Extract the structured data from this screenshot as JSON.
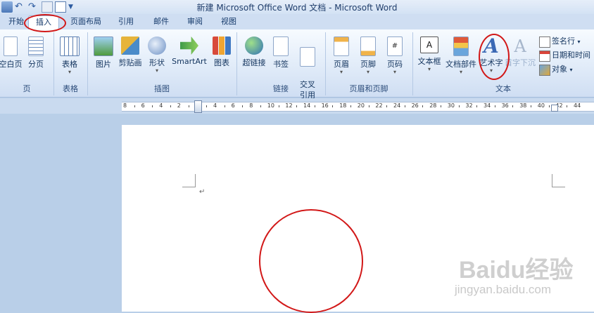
{
  "window": {
    "title": "新建 Microsoft Office Word 文档 - Microsoft Word"
  },
  "tabs": [
    {
      "label": "开始"
    },
    {
      "label": "插入"
    },
    {
      "label": "页面布局"
    },
    {
      "label": "引用"
    },
    {
      "label": "邮件"
    },
    {
      "label": "审阅"
    },
    {
      "label": "视图"
    }
  ],
  "ribbon": {
    "groups": {
      "pages": {
        "label": "页",
        "buttons": [
          "空白页",
          "分页"
        ]
      },
      "tables": {
        "label": "表格",
        "buttons": [
          "表格"
        ]
      },
      "illustrations": {
        "label": "插图",
        "buttons": [
          "图片",
          "剪贴画",
          "形状",
          "SmartArt",
          "图表"
        ]
      },
      "links": {
        "label": "链接",
        "buttons": [
          "超链接",
          "书签",
          "交叉\n引用"
        ]
      },
      "header_footer": {
        "label": "页眉和页脚",
        "buttons": [
          "页眉",
          "页脚",
          "页码"
        ]
      },
      "text": {
        "label": "文本",
        "buttons": [
          "文本框",
          "文档部件",
          "艺术字",
          "首字下沉"
        ],
        "small_buttons": [
          "签名行",
          "日期和时间",
          "对象"
        ]
      }
    }
  },
  "ruler": {
    "numbers": [
      "8",
      "6",
      "4",
      "2",
      "2",
      "4",
      "6",
      "8",
      "10",
      "12",
      "14",
      "16",
      "18",
      "20",
      "22",
      "24",
      "26",
      "28",
      "30",
      "32",
      "34",
      "36",
      "38",
      "40",
      "42",
      "44"
    ]
  },
  "document": {
    "paragraph_mark": "↵"
  },
  "watermark": {
    "line1": "Baidu经验",
    "line2": "jingyan.baidu.com"
  },
  "colors": {
    "highlight_red": "#d21818",
    "ribbon_blue": "#cfdef2"
  }
}
